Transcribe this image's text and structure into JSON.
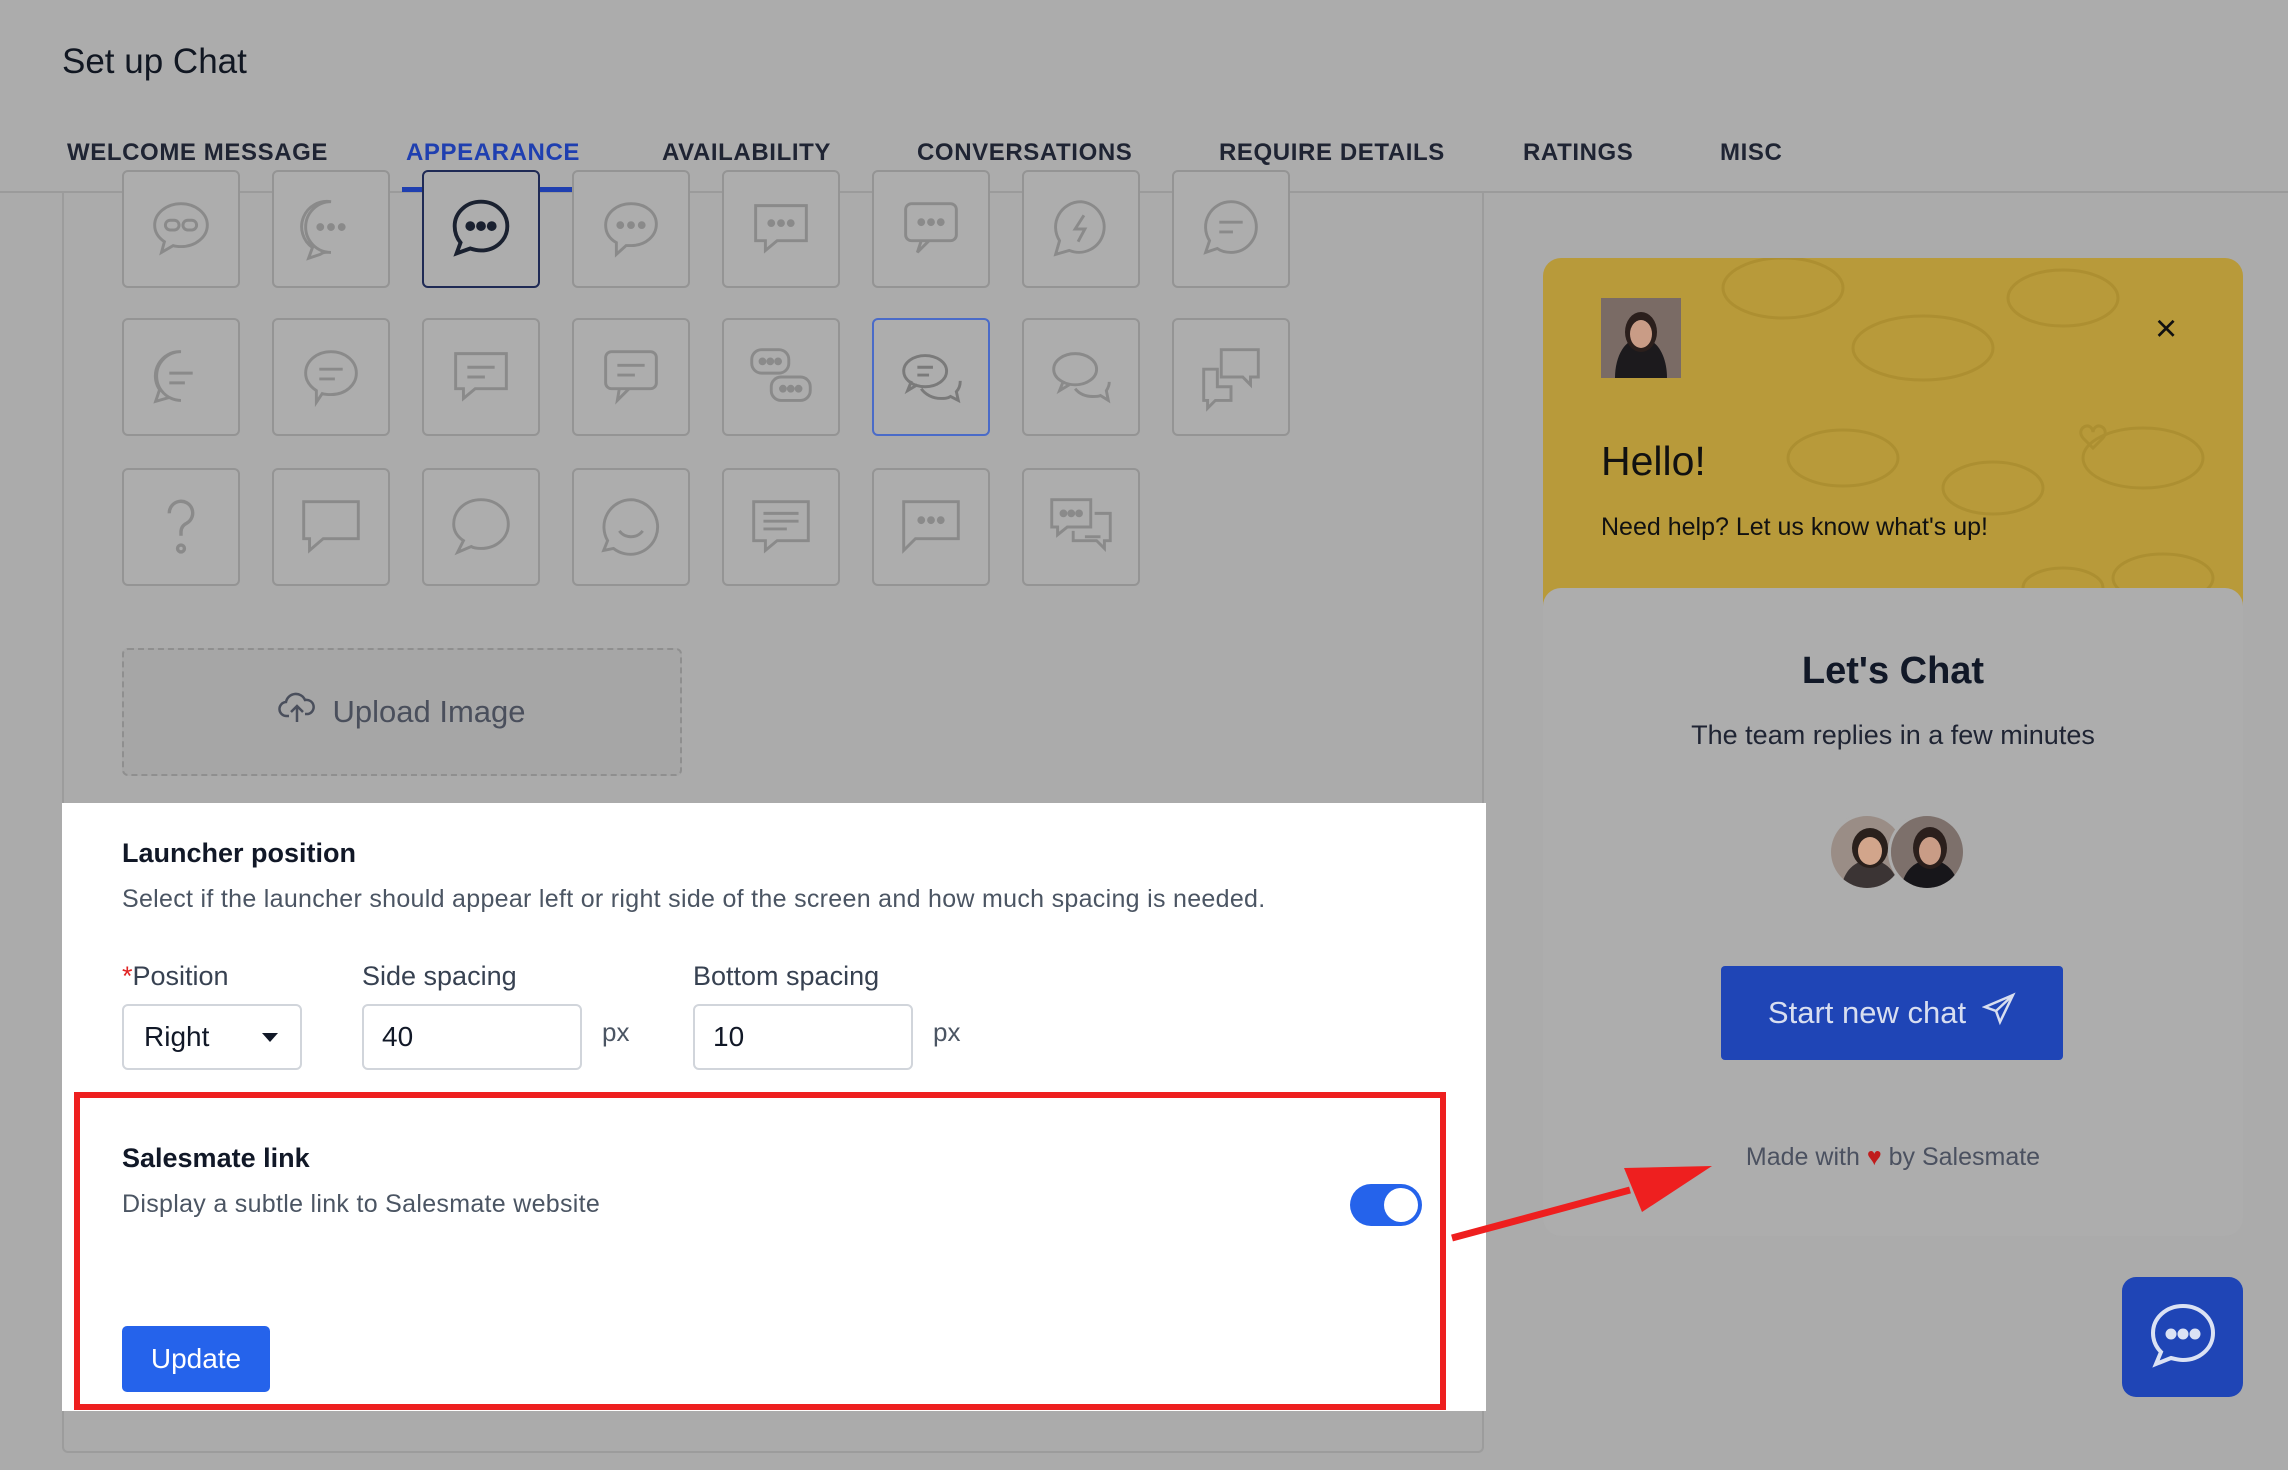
{
  "header": {
    "title": "Set up Chat",
    "tabs": [
      {
        "label": "WELCOME MESSAGE",
        "active": false
      },
      {
        "label": "APPEARANCE",
        "active": true
      },
      {
        "label": "AVAILABILITY",
        "active": false
      },
      {
        "label": "CONVERSATIONS",
        "active": false
      },
      {
        "label": "REQUIRE DETAILS",
        "active": false
      },
      {
        "label": "RATINGS",
        "active": false
      },
      {
        "label": "MISC",
        "active": false
      }
    ]
  },
  "appearance": {
    "icon_grid": {
      "rows": [
        [
          "chat-bubble-link-icon",
          "chat-bubble-dots-icon",
          "chat-bubble-dots-bold-icon",
          "chat-bubble-dots-tail-icon",
          "chat-square-dots-icon",
          "chat-square-dots-alt-icon",
          "messenger-bolt-icon",
          "chat-bubble-lines-icon"
        ],
        [
          "chat-bubble-lines-alt-icon",
          "chat-bubble-lines-round-icon",
          "chat-square-lines-icon",
          "chat-square-lines-alt-icon",
          "chat-double-dots-icon",
          "chat-double-bubble-icon",
          "chat-double-outline-icon",
          "chat-double-square-icon"
        ],
        [
          "question-mark-icon",
          "chat-square-empty-icon",
          "chat-bubble-empty-icon",
          "chat-round-bubble-icon",
          "chat-square-text-icon",
          "chat-square-dots-flat-icon",
          "chat-double-square-dots-icon"
        ]
      ],
      "selected": "chat-bubble-dots-bold-icon",
      "hovered": "chat-double-bubble-icon"
    },
    "upload_label": "Upload Image",
    "upload_icon": "cloud-upload-icon"
  },
  "launcher_position": {
    "title": "Launcher position",
    "description": "Select if the launcher should appear left or right side of the screen and how much spacing is needed.",
    "position_label": "Position",
    "required_mark": "*",
    "position_value": "Right",
    "side_spacing_label": "Side spacing",
    "side_spacing_value": "40",
    "bottom_spacing_label": "Bottom spacing",
    "bottom_spacing_value": "10",
    "unit": "px"
  },
  "salesmate_link": {
    "title": "Salesmate link",
    "description": "Display a subtle link to Salesmate website",
    "enabled": true
  },
  "update_label": "Update",
  "widget": {
    "hello": "Hello!",
    "need_help": "Need help? Let us know what's up!",
    "close_glyph": "×",
    "lets_chat": "Let's Chat",
    "team_replies": "The team replies in a few minutes",
    "start_chat": "Start new chat",
    "made_with_prefix": "Made with",
    "heart": "♥",
    "made_with_suffix": "by Salesmate"
  },
  "colors": {
    "accent": "#2563eb",
    "active_tab": "#1f3fb0",
    "widget_header": "#b89a3a",
    "widget_button": "#1f45b6",
    "annotation_red": "#ee1f1f"
  }
}
